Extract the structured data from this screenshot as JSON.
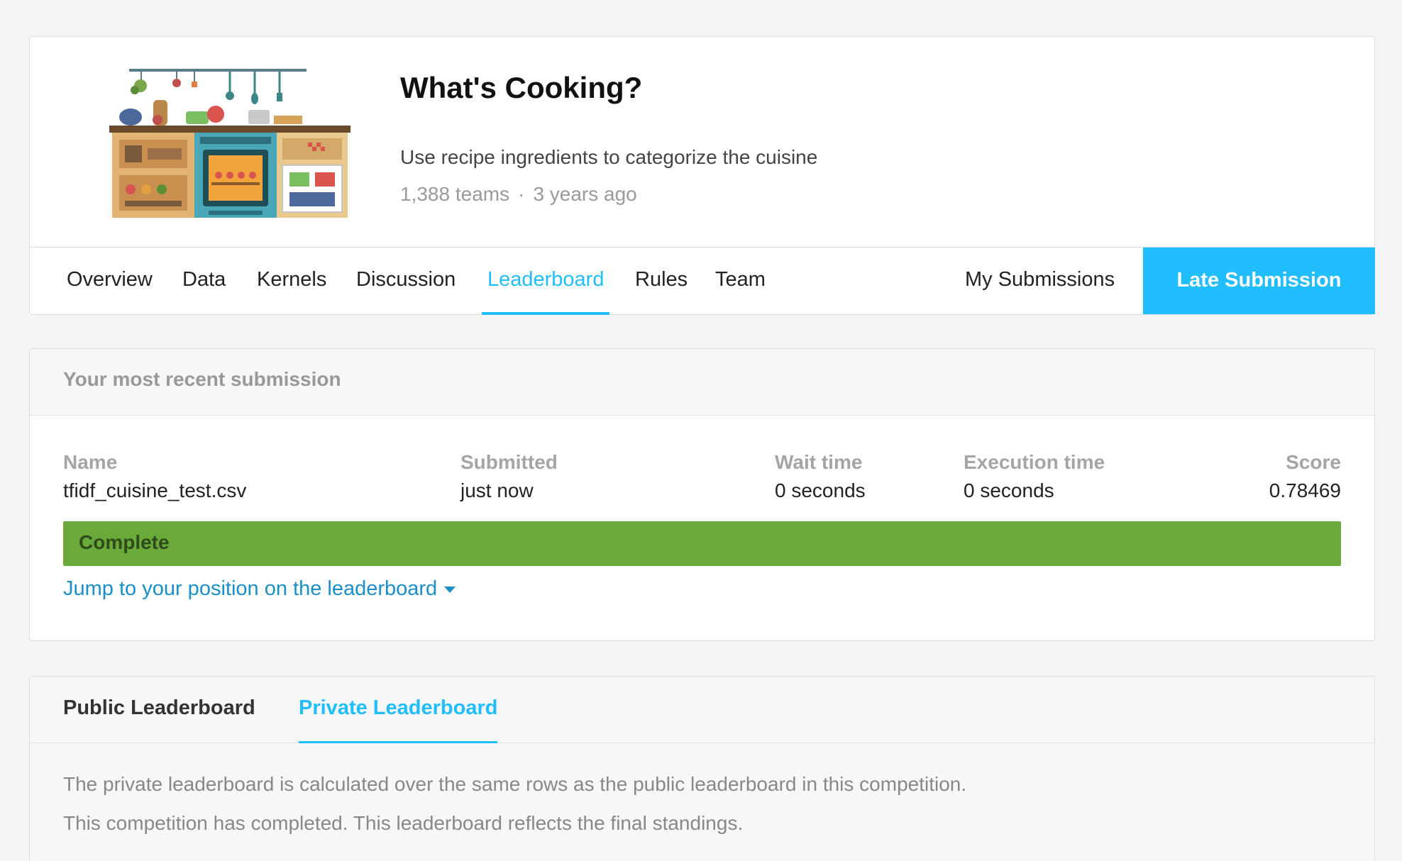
{
  "competition": {
    "title": "What's Cooking?",
    "description": "Use recipe ingredients to categorize the cuisine",
    "teams": "1,388 teams",
    "separator": "·",
    "age": "3 years ago",
    "image_icon": "kitchen-illustration"
  },
  "tabs": {
    "items": [
      {
        "label": "Overview"
      },
      {
        "label": "Data"
      },
      {
        "label": "Kernels"
      },
      {
        "label": "Discussion"
      },
      {
        "label": "Leaderboard"
      },
      {
        "label": "Rules"
      },
      {
        "label": "Team"
      }
    ],
    "active": "Leaderboard",
    "my_submissions": "My Submissions",
    "late_submission": "Late Submission"
  },
  "submission": {
    "heading": "Your most recent submission",
    "columns": {
      "name": {
        "label": "Name",
        "value": "tfidf_cuisine_test.csv"
      },
      "submitted": {
        "label": "Submitted",
        "value": "just now"
      },
      "wait": {
        "label": "Wait time",
        "value": "0 seconds"
      },
      "execution": {
        "label": "Execution time",
        "value": "0 seconds"
      },
      "score": {
        "label": "Score",
        "value": "0.78469"
      }
    },
    "status": "Complete",
    "jump_link": "Jump to your position on the leaderboard"
  },
  "leaderboard": {
    "tabs": [
      {
        "label": "Public Leaderboard"
      },
      {
        "label": "Private Leaderboard"
      }
    ],
    "active": "Private Leaderboard",
    "notes": [
      "The private leaderboard is calculated over the same rows as the public leaderboard in this competition.",
      "This competition has completed. This leaderboard reflects the final standings."
    ]
  },
  "colors": {
    "accent": "#20beff",
    "complete": "#6aaa3a",
    "link": "#1a8fc8"
  }
}
